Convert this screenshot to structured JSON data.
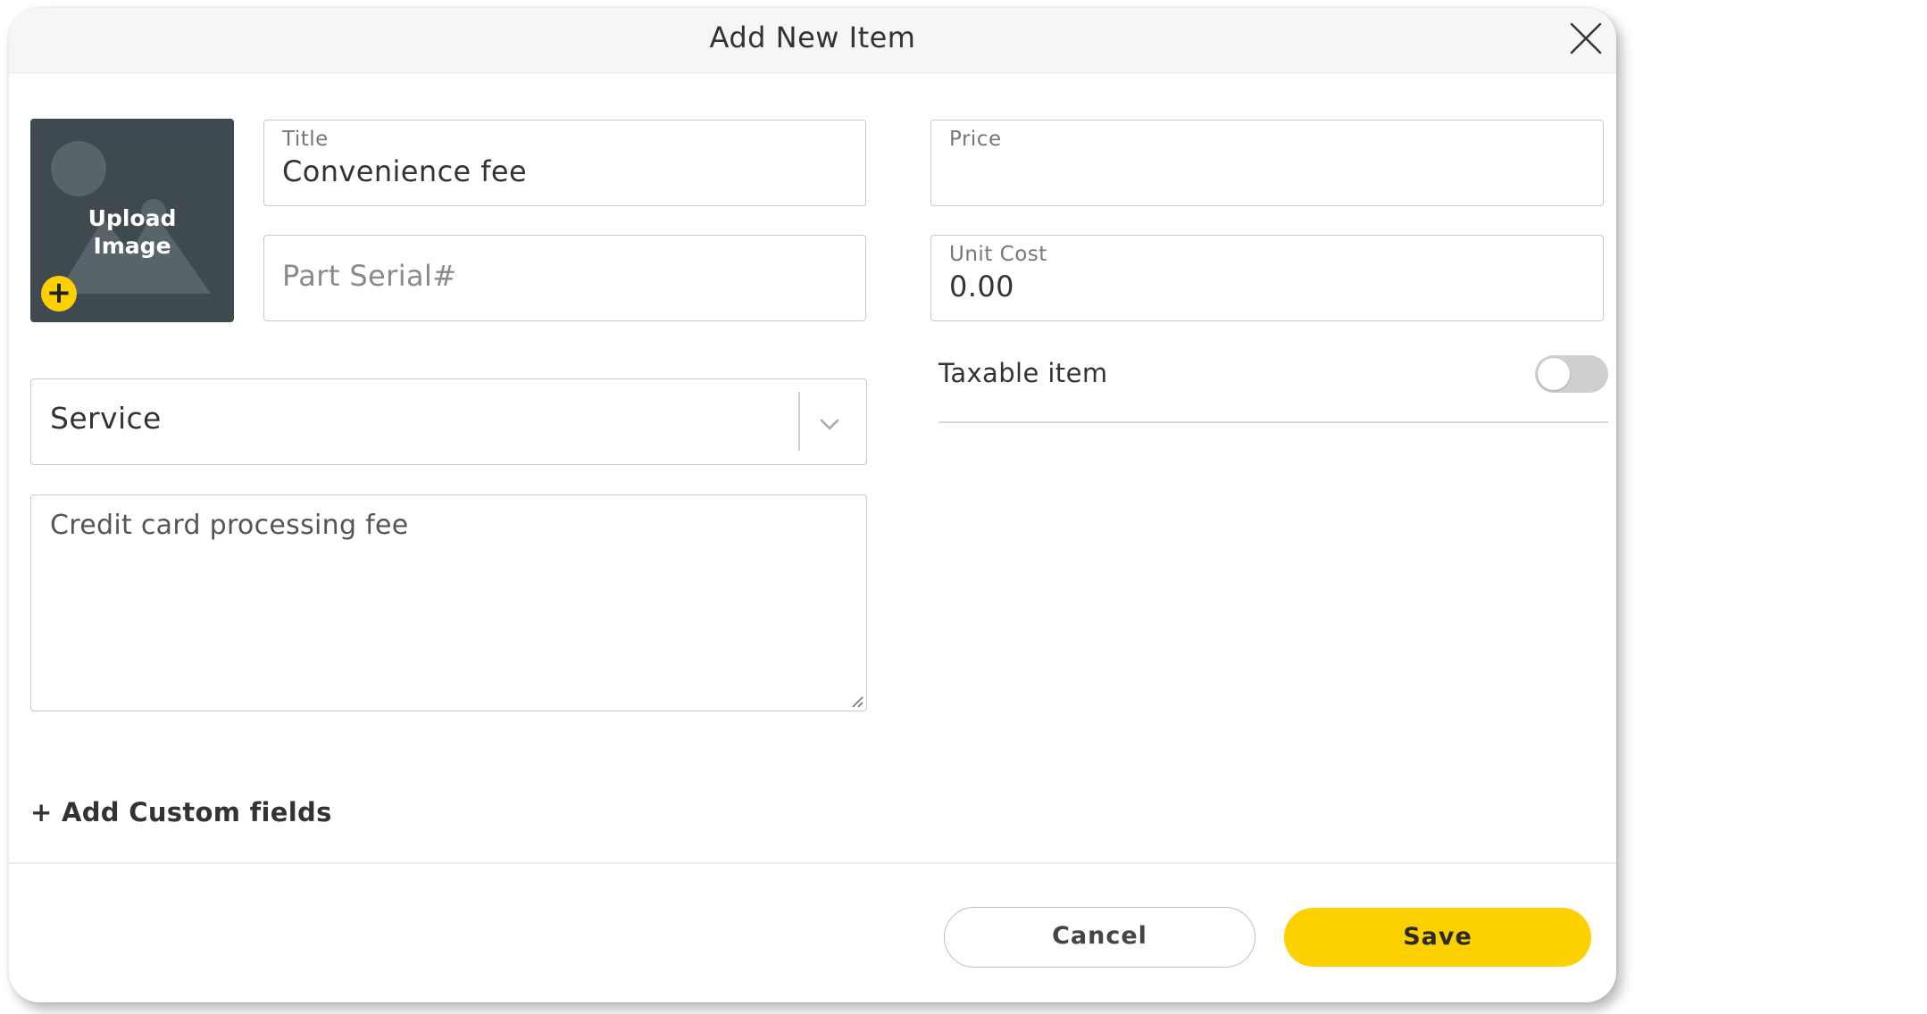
{
  "modal": {
    "title": "Add New Item",
    "close_icon": "close-icon"
  },
  "upload": {
    "label": "Upload\nImage",
    "plus_icon": "plus-icon",
    "plus_glyph": "+"
  },
  "fields": {
    "title": {
      "label": "Title",
      "value": "Convenience fee"
    },
    "part_serial": {
      "placeholder": "Part Serial#"
    },
    "price": {
      "label": "Price",
      "value": ""
    },
    "unit_cost": {
      "label": "Unit Cost",
      "value": "0.00"
    }
  },
  "type_select": {
    "value": "Service",
    "chevron_icon": "chevron-down-icon"
  },
  "description": {
    "value": "Credit card processing fee"
  },
  "taxable": {
    "label": "Taxable item",
    "enabled": false
  },
  "custom_fields": {
    "link_label": "+ Add Custom fields"
  },
  "footer": {
    "cancel_label": "Cancel",
    "save_label": "Save"
  },
  "colors": {
    "accent": "#fdd000",
    "upload_bg": "#3e4a4f",
    "toggle_off": "#cfcfcf"
  }
}
